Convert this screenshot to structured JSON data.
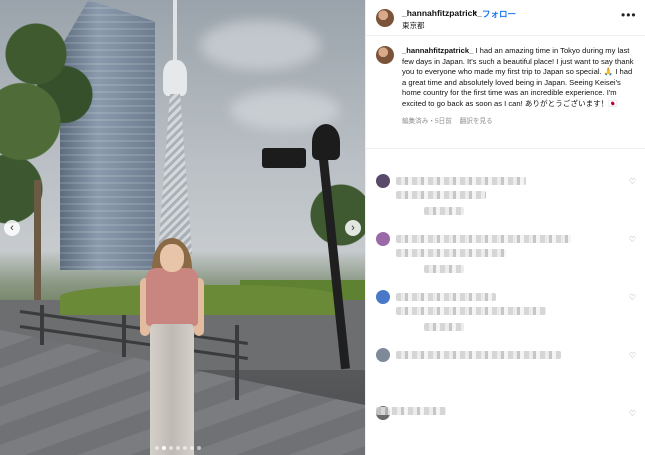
{
  "post": {
    "username": "_hannahfitzpatrick_",
    "separator": "•",
    "follow_label": "フォロー",
    "location": "東京都",
    "more_label": "•••",
    "caption_text": " I had an amazing time in Tokyo during my last few days in Japan. It's such a beautiful place! I just want to say thank you to everyone who made my first trip to Japan so special. 🙏 I had a great time and absolutely loved being in Japan. Seeing Keisei's home country for the first time was an incredible experience. I'm excited to go back as soon as I can! ありがとうございます！🇯🇵",
    "edited_label": "編集済み・5日前",
    "translate_label": "翻訳を見る"
  },
  "photo": {
    "prev_label": "‹",
    "next_label": "›",
    "slide_count": 7,
    "active_slide": 1
  },
  "comments": [
    {
      "avatar_color": "#5a4a6a",
      "heart": "♡"
    },
    {
      "avatar_color": "#9a6aa8",
      "heart": "♡"
    },
    {
      "avatar_color": "#4a78c8",
      "heart": "♡"
    },
    {
      "avatar_color": "#7e8a9a",
      "heart": "♡"
    },
    {
      "avatar_color": "#6a6a6a",
      "heart": "♡"
    }
  ],
  "colors": {
    "follow": "#1877f2",
    "meta": "#8e8e8e"
  }
}
